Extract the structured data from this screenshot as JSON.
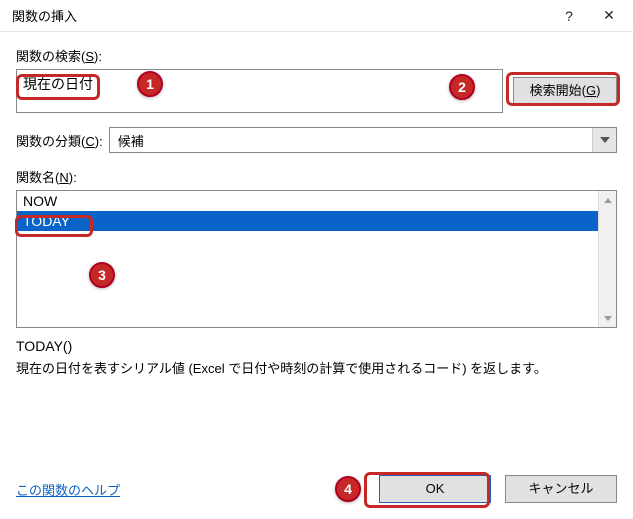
{
  "titlebar": {
    "title": "関数の挿入",
    "help": "?",
    "close": "✕"
  },
  "search": {
    "label_pre": "関数の検索(",
    "label_key": "S",
    "label_post": "):",
    "text": "現在の日付",
    "go_pre": "検索開始(",
    "go_key": "G",
    "go_post": ")"
  },
  "category": {
    "label_pre": "関数の分類(",
    "label_key": "C",
    "label_post": "):",
    "value": "候補"
  },
  "list": {
    "label_pre": "関数名(",
    "label_key": "N",
    "label_post": "):",
    "items": [
      {
        "name": "NOW",
        "selected": false
      },
      {
        "name": "TODAY",
        "selected": true
      }
    ]
  },
  "description": {
    "syntax": "TODAY()",
    "text": "現在の日付を表すシリアル値 (Excel で日付や時刻の計算で使用されるコード) を返します。"
  },
  "footer": {
    "help": "この関数のヘルプ",
    "ok": "OK",
    "cancel": "キャンセル"
  },
  "annotations": {
    "n1": "1",
    "n2": "2",
    "n3": "3",
    "n4": "4"
  }
}
